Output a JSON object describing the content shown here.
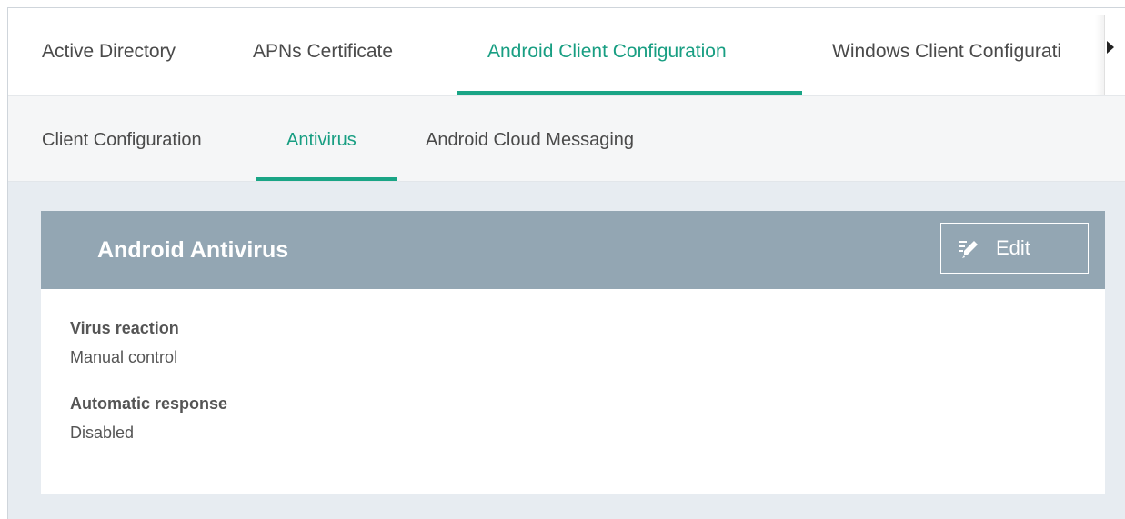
{
  "main_tabs": [
    {
      "label": "Active Directory",
      "active": false
    },
    {
      "label": "APNs Certificate",
      "active": false
    },
    {
      "label": "Android Client Configuration",
      "active": true
    },
    {
      "label": "Windows Client Configurati",
      "active": false
    }
  ],
  "sub_tabs": [
    {
      "label": "Client Configuration",
      "active": false
    },
    {
      "label": "Antivirus",
      "active": true
    },
    {
      "label": "Android Cloud Messaging",
      "active": false
    }
  ],
  "panel": {
    "title": "Android Antivirus",
    "edit_label": "Edit",
    "fields": [
      {
        "label": "Virus reaction",
        "value": "Manual control"
      },
      {
        "label": "Automatic response",
        "value": "Disabled"
      }
    ]
  },
  "colors": {
    "accent": "#1aa586",
    "panel_header": "#93a6b3",
    "background": "#e7ecf1"
  },
  "icons": {
    "tab_scroll": "chevron-right-icon",
    "edit": "pencil-icon"
  }
}
